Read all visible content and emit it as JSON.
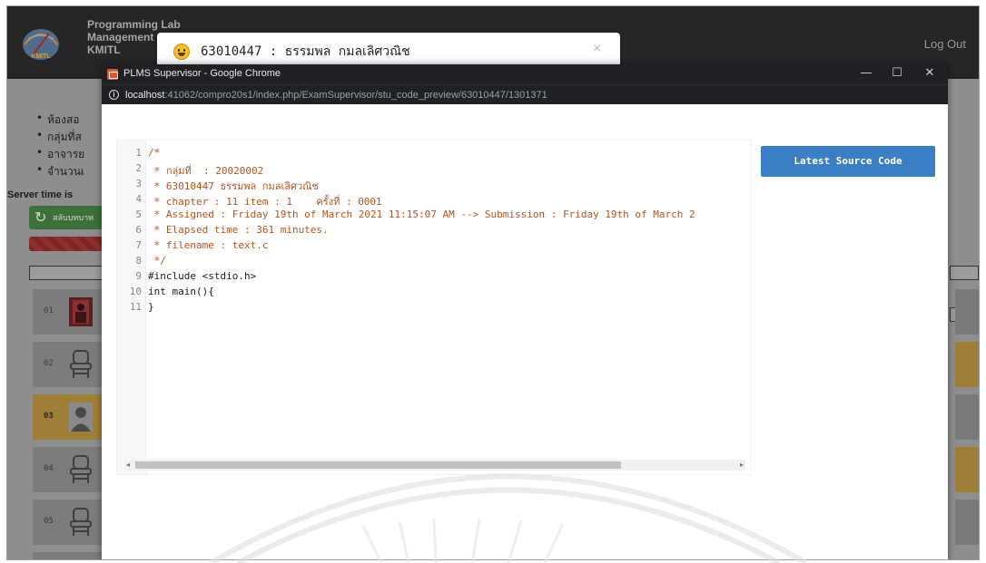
{
  "app": {
    "brand_line1": "Programming Lab",
    "brand_line2": "Management",
    "brand_line3": "KMITL",
    "logo_text": "KMITL",
    "logout": "Log Out"
  },
  "background": {
    "list_items": [
      "ห้องสอ",
      "กลุ่มที่ส",
      "อาจารย",
      "จำนวนเ"
    ],
    "server_time": "Server time is",
    "reorder_label": "สลับบทบาท",
    "seats": [
      "01",
      "02",
      "03",
      "04",
      "05"
    ]
  },
  "toast": {
    "text": "63010447 : ธรรมพล กมลเลิศวณิช",
    "close": "×"
  },
  "popup": {
    "title": "PLMS Supervisor - Google Chrome",
    "url_host": "localhost",
    "url_path": ":41062/compro20s1/index.php/ExamSupervisor/stu_code_preview/63010447/1301371",
    "minimize": "—",
    "maximize": "☐",
    "close": "✕",
    "latest_button": "Latest Source Code"
  },
  "code": {
    "line_numbers": [
      "1",
      "2",
      "3",
      "4",
      "5",
      "6",
      "7",
      "8",
      "9",
      "10",
      "11"
    ],
    "lines": [
      "/*",
      " * กลุ่มที่  : 20020002",
      " * 63010447 ธรรมพล กมลเลิศวณิช",
      " * chapter : 11 item : 1    ครั้งที่ : 0001",
      " * Assigned : Friday 19th of March 2021 11:15:07 AM --> Submission : Friday 19th of March 2",
      " * Elapsed time : 361 minutes.",
      " * filename : text.c",
      " */",
      "#include <stdio.h>",
      "int main(){",
      "}"
    ]
  },
  "colors": {
    "comment": "#b3541e",
    "button": "#3a7fc3",
    "titlebar": "#202124"
  }
}
